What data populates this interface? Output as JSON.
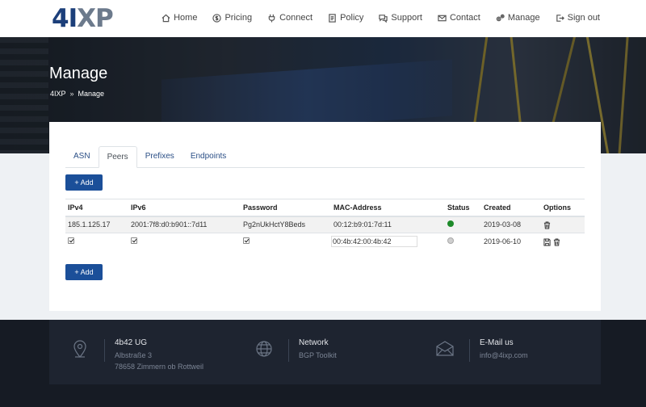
{
  "brand": {
    "logo_part1": "4I",
    "logo_part2": "XP"
  },
  "nav": [
    {
      "label": "Home",
      "icon": "home-icon"
    },
    {
      "label": "Pricing",
      "icon": "dollar-icon"
    },
    {
      "label": "Connect",
      "icon": "plug-icon"
    },
    {
      "label": "Policy",
      "icon": "document-icon"
    },
    {
      "label": "Support",
      "icon": "chat-icon"
    },
    {
      "label": "Contact",
      "icon": "mail-icon"
    },
    {
      "label": "Manage",
      "icon": "gears-icon"
    },
    {
      "label": "Sign out",
      "icon": "sign-out-icon"
    }
  ],
  "hero": {
    "title": "Manage",
    "breadcrumb": [
      "4IXP",
      "Manage"
    ]
  },
  "tabs": [
    "ASN",
    "Peers",
    "Prefixes",
    "Endpoints"
  ],
  "active_tab": "Peers",
  "add_label": "+ Add",
  "table": {
    "headers": [
      "IPv4",
      "IPv6",
      "Password",
      "MAC-Address",
      "Status",
      "Created",
      "Options"
    ],
    "rows": [
      {
        "ipv4": "185.1.125.17",
        "ipv6": "2001:7f8:d0:b901::7d11",
        "password": "Pg2nUkHctY8Beds",
        "mac": "00:12:b9:01:7d:11",
        "status": "active",
        "created": "2019-03-08"
      },
      {
        "ipv4_checked": true,
        "ipv6_checked": true,
        "password_checked": true,
        "mac_value": "00:4b:42:00:4b:42",
        "status": "inactive",
        "created": "2019-06-10"
      }
    ]
  },
  "footer": {
    "company": {
      "title": "4b42 UG",
      "line1": "Albstraße 3",
      "line2": "78658 Zimmern ob Rottweil"
    },
    "network": {
      "title": "Network",
      "line1": "BGP Toolkit"
    },
    "email": {
      "title": "E-Mail us",
      "line1": "info@4ixp.com"
    }
  },
  "colors": {
    "accent": "#1b4f99",
    "status_on": "#1e8a2a",
    "footer_bg": "#161b24"
  }
}
